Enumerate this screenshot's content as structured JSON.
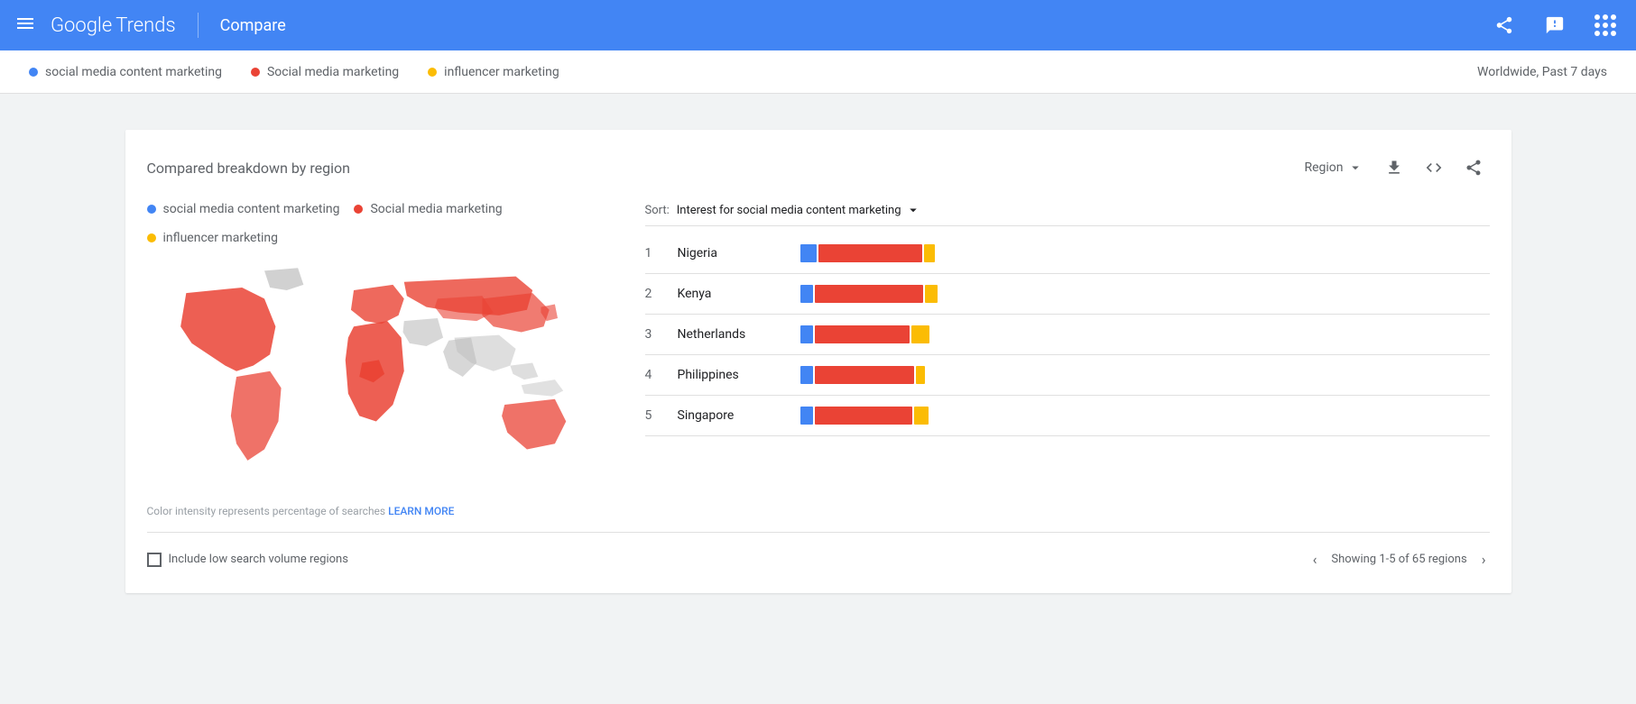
{
  "header": {
    "menu_label": "☰",
    "logo_google": "Google",
    "logo_trends": "Trends",
    "compare": "Compare",
    "share_tooltip": "Share",
    "feedback_tooltip": "Feedback",
    "apps_tooltip": "Apps"
  },
  "legend_bar": {
    "term1": "social media content marketing",
    "term2": "Social media marketing",
    "term3": "influencer marketing",
    "filter": "Worldwide, Past 7 days",
    "dot1_color": "#4285f4",
    "dot2_color": "#ea4335",
    "dot3_color": "#fbbc04"
  },
  "card": {
    "title": "Compared breakdown by region",
    "region_label": "Region",
    "sort_prefix": "Sort:",
    "sort_value": "Interest for social media content marketing",
    "map_note": "Color intensity represents percentage of searches",
    "learn_more": "LEARN MORE",
    "legend": {
      "term1": "social media content marketing",
      "term2": "Social media marketing",
      "term3": "influencer marketing",
      "dot1_color": "#4285f4",
      "dot2_color": "#ea4335",
      "dot3_color": "#fbbc04"
    },
    "regions": [
      {
        "rank": "1",
        "name": "Nigeria",
        "blue_w": 18,
        "red_w": 115,
        "yellow_w": 12
      },
      {
        "rank": "2",
        "name": "Kenya",
        "blue_w": 14,
        "red_w": 120,
        "yellow_w": 14
      },
      {
        "rank": "3",
        "name": "Netherlands",
        "blue_w": 14,
        "red_w": 105,
        "yellow_w": 20
      },
      {
        "rank": "4",
        "name": "Philippines",
        "blue_w": 14,
        "red_w": 110,
        "yellow_w": 10
      },
      {
        "rank": "5",
        "name": "Singapore",
        "blue_w": 14,
        "red_w": 108,
        "yellow_w": 16
      }
    ],
    "footer": {
      "checkbox_label": "Include low search volume regions",
      "pagination_text": "Showing 1-5 of 65 regions"
    }
  }
}
